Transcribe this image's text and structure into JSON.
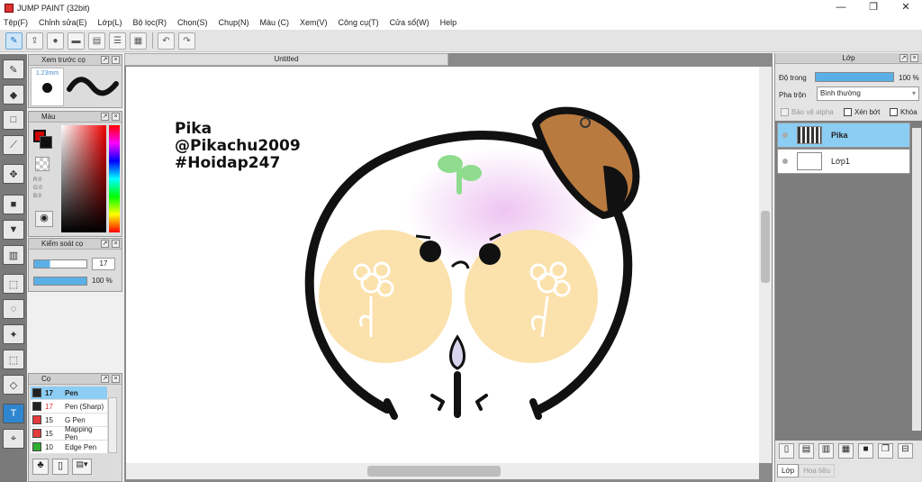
{
  "window": {
    "title": "JUMP PAINT (32bit)",
    "controls": [
      "—",
      "❐",
      "✕"
    ]
  },
  "menu": [
    "Tệp(F)",
    "Chỉnh sửa(E)",
    "Lớp(L)",
    "Bộ lọc(R)",
    "Chọn(S)",
    "Chụp(N)",
    "Màu (C)",
    "Xem(V)",
    "Công cụ(T)",
    "Cửa sổ(W)",
    "Help"
  ],
  "toolbar_icons": [
    "brush-settings-icon",
    "export-icon",
    "comment-icon",
    "speech-bubble-icon",
    "page-icon",
    "list-icon",
    "layout-icon",
    "undo-icon",
    "redo-icon"
  ],
  "tools": [
    "brush-icon",
    "eraser-icon",
    "rectangle-icon",
    "pen-icon",
    "move-icon",
    "fill-rect-icon",
    "bucket-icon",
    "gradient-icon",
    "select-rect-icon",
    "lasso-icon",
    "magic-wand-icon",
    "select-pen-icon",
    "select-eraser-icon",
    "text-icon",
    "eyedropper-icon"
  ],
  "brush_preview": {
    "title": "Xem trước cọ",
    "size": "1.23mm"
  },
  "color_panel": {
    "title": "Màu",
    "r": "R:0",
    "g": "G:0",
    "b": "B:0"
  },
  "brush_control": {
    "title": "Kiểm soát cọ",
    "size": "17",
    "opacity": "100 %"
  },
  "brush_list": {
    "title": "Cọ",
    "items": [
      {
        "size": "17",
        "name": "Pen",
        "color": "#222222"
      },
      {
        "size": "17",
        "name": "Pen (Sharp)",
        "color": "#222222"
      },
      {
        "size": "15",
        "name": "G Pen",
        "color": "#e23b3b"
      },
      {
        "size": "15",
        "name": "Mapping Pen",
        "color": "#e23b3b"
      },
      {
        "size": "10",
        "name": "Edge Pen",
        "color": "#2fae2f"
      }
    ]
  },
  "document": {
    "tab": "Untitled"
  },
  "artwork_text": [
    "Pika",
    "@Pikachu2009",
    "#Hoidap247"
  ],
  "layer_panel": {
    "title": "Lớp",
    "opacity_label": "Độ trong",
    "opacity_value": "100 %",
    "blend_label": "Pha trộn",
    "blend_value": "Bình thường",
    "protect_alpha": "Bảo vệ alpha",
    "clipping": "Xén bớt",
    "lock": "Khóa",
    "layers": [
      "Pika",
      "Lớp1"
    ],
    "bottom_tabs": [
      "Lớp",
      "Hoa tiêu"
    ]
  }
}
